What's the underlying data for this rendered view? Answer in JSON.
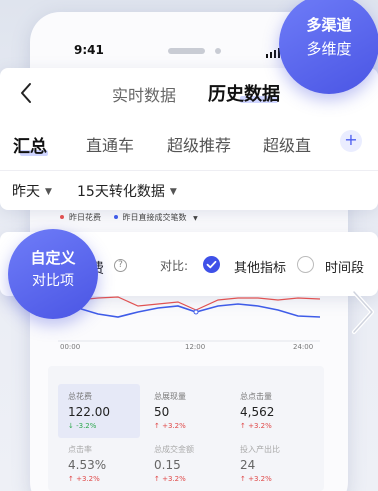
{
  "status": {
    "time": "9:41"
  },
  "header": {
    "tabs": [
      {
        "label": "实时数据",
        "active": false
      },
      {
        "label": "历史数据",
        "active": true
      }
    ]
  },
  "subtabs": {
    "items": [
      {
        "label": "汇总",
        "active": true
      },
      {
        "label": "直通车",
        "active": false
      },
      {
        "label": "超级推荐",
        "active": false
      },
      {
        "label": "超级直",
        "active": false
      }
    ]
  },
  "filters": {
    "date": "昨天",
    "conversion": "15天转化数据"
  },
  "legend": {
    "items": [
      {
        "label": "昨日花费",
        "color": "#e05252"
      },
      {
        "label": "昨日直接成交笔数",
        "color": "#3f5ce8"
      }
    ]
  },
  "compare": {
    "metric_fragment": "费",
    "label": "对比:",
    "options": [
      {
        "label": "其他指标",
        "selected": true
      },
      {
        "label": "时间段",
        "selected": false
      }
    ]
  },
  "chart_data": {
    "type": "line",
    "x_labels": [
      "00:00",
      "12:00",
      "24:00"
    ]
  },
  "stats": [
    {
      "label": "总花费",
      "value": "122.00",
      "change": "↓ -3.2%",
      "selected": true
    },
    {
      "label": "总展现量",
      "value": "50",
      "change": "↑ +3.2%",
      "selected": false
    },
    {
      "label": "总点击量",
      "value": "4,562",
      "change": "↑ +3.2%",
      "selected": false
    },
    {
      "label": "点击率",
      "value": "4.53%",
      "change": "↑ +3.2%",
      "selected": false
    },
    {
      "label": "总成交金额",
      "value": "0.15",
      "change": "↑ +3.2%",
      "selected": false
    },
    {
      "label": "投入产出比",
      "value": "24",
      "change": "↑ +3.2%",
      "selected": false
    }
  ],
  "badges": {
    "multi": {
      "line1": "多渠道",
      "line2": "多维度"
    },
    "custom": {
      "line1": "自定义",
      "line2": "对比项"
    }
  },
  "colors": {
    "accent": "#3f51e8",
    "spend_line": "#e05252",
    "orders_line": "#3f5ce8",
    "up": "#e04848",
    "down": "#2ea84f"
  }
}
